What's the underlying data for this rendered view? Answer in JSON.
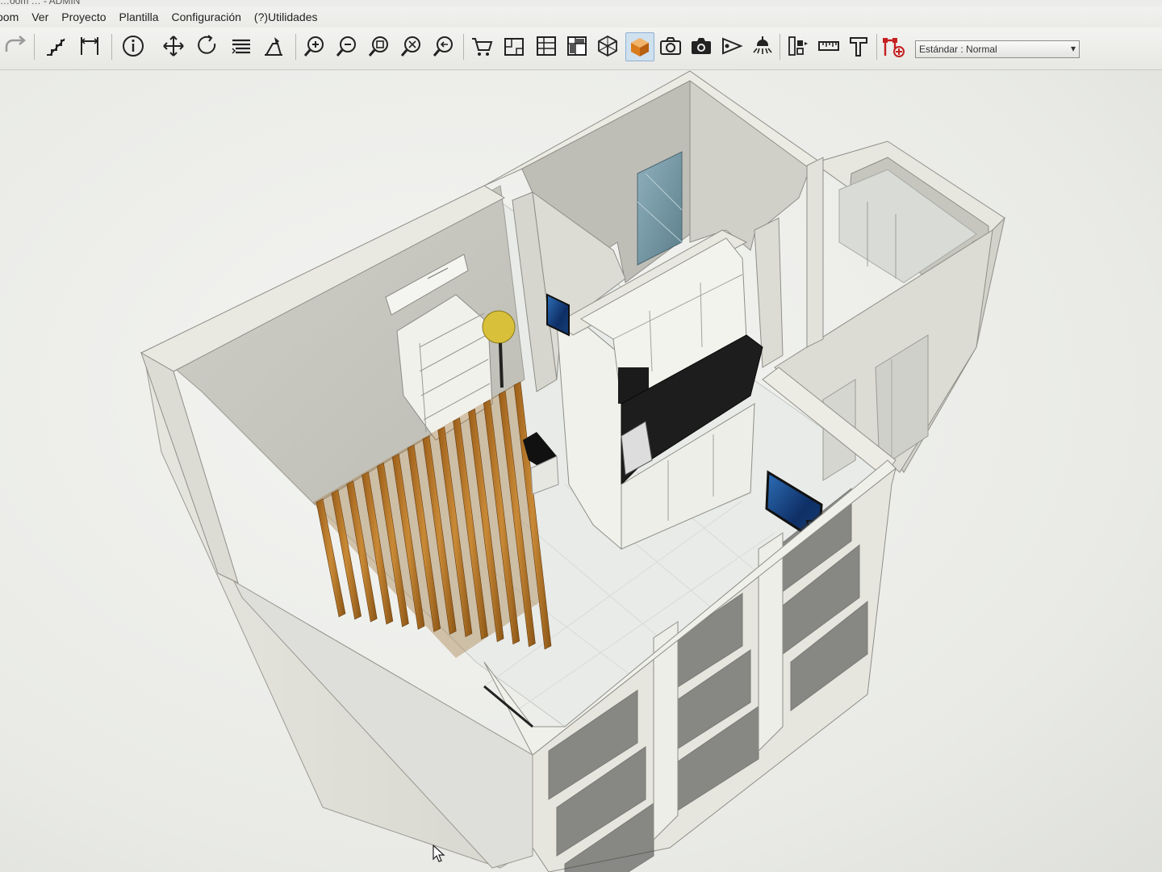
{
  "window": {
    "title": "…oom … - ADMIN"
  },
  "menu": {
    "items": [
      "oom",
      "Ver",
      "Proyecto",
      "Plantilla",
      "Configuración",
      "(?)Utilidades"
    ]
  },
  "toolbar": {
    "tools": [
      {
        "icon": "redo-icon"
      },
      {
        "icon": "stairs-icon"
      },
      {
        "icon": "dimension-icon"
      },
      {
        "icon": "info-icon"
      },
      {
        "icon": "move-icon"
      },
      {
        "icon": "rotate-icon"
      },
      {
        "icon": "layers-icon"
      },
      {
        "icon": "sign-icon"
      },
      {
        "icon": "zoom-in-icon"
      },
      {
        "icon": "zoom-out-icon"
      },
      {
        "icon": "zoom-window-icon"
      },
      {
        "icon": "zoom-all-icon"
      },
      {
        "icon": "zoom-previous-icon"
      },
      {
        "icon": "cart-icon"
      },
      {
        "icon": "elevation-icon"
      },
      {
        "icon": "plan-icon"
      },
      {
        "icon": "plan-color-icon"
      },
      {
        "icon": "wireframe-icon"
      },
      {
        "icon": "render-3d-icon"
      },
      {
        "icon": "camera-icon"
      },
      {
        "icon": "photo-camera-icon"
      },
      {
        "icon": "light-direction-icon"
      },
      {
        "icon": "lamp-icon"
      },
      {
        "icon": "materials-icon"
      },
      {
        "icon": "measure-icon"
      },
      {
        "icon": "paint-icon"
      },
      {
        "icon": "add-path-icon"
      }
    ],
    "view_select": {
      "value": "Estándar : Normal"
    }
  },
  "colors": {
    "accent": "#d58a2a",
    "wall_top": "#e4e4dc",
    "wall_side": "#d3d3cb",
    "floor": "#e8ebe8",
    "wood": "#b8782a",
    "countertop": "#1c1c1c",
    "lamp": "#d9c23a",
    "door_glass": "#7a9aa6"
  }
}
